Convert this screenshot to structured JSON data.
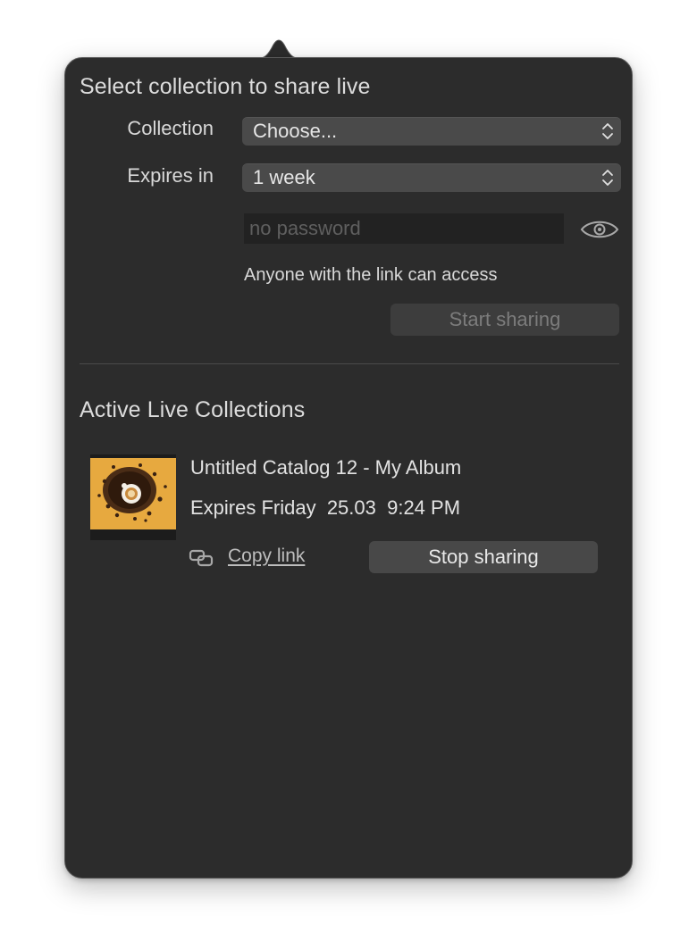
{
  "share": {
    "section_title": "Select collection to share live",
    "collection_label": "Collection",
    "collection_value": "Choose...",
    "expires_label": "Expires in",
    "expires_value": "1 week",
    "password_placeholder": "no password",
    "password_value": "",
    "access_note": "Anyone with the link can access",
    "start_label": "Start sharing"
  },
  "active": {
    "section_title": "Active Live Collections",
    "items": [
      {
        "title": "Untitled Catalog 12 - My Album",
        "expires": "Expires Friday  25.03  9:24 PM",
        "copy_link_label": "Copy link",
        "stop_label": "Stop sharing",
        "thumbnail": "coffee-cup-on-beans-image"
      }
    ]
  },
  "icons": {
    "chevron": "up-down-chevron-icon",
    "reveal": "eye-icon",
    "link": "link-icon"
  },
  "colors": {
    "panel": "#2c2c2c",
    "control": "#4a4a4a",
    "thumbnail_bg": "#e7a93f"
  }
}
